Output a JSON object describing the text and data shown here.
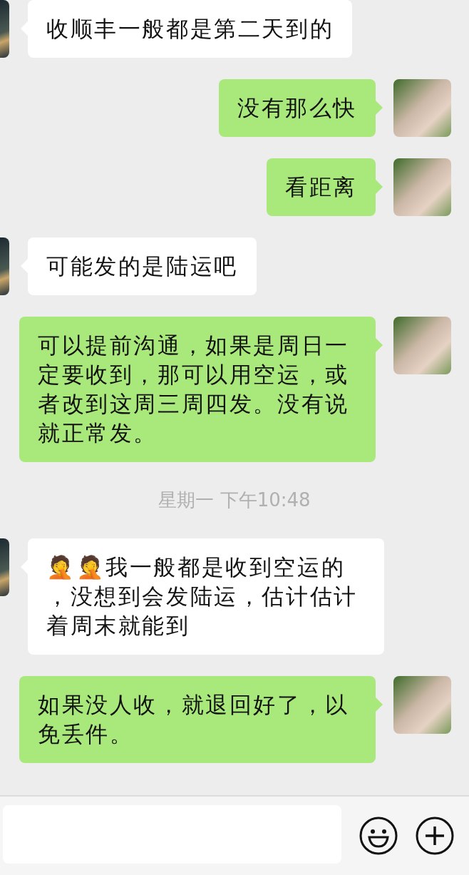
{
  "messages": [
    {
      "kind": "incoming",
      "text": "收顺丰一般都是第二天到的"
    },
    {
      "kind": "outgoing",
      "text": "没有那么快"
    },
    {
      "kind": "outgoing",
      "text": "看距离"
    },
    {
      "kind": "incoming",
      "text": "可能发的是陆运吧"
    },
    {
      "kind": "outgoing",
      "text": "可以提前沟通，如果是周日一定要收到，那可以用空运，或者改到这周三周四发。没有说就正常发。"
    },
    {
      "kind": "time",
      "text": "星期一 下午10:48"
    },
    {
      "kind": "incoming",
      "text": "🤦🤦我一般都是收到空运的，没想到会发陆运，估计估计着周末就能到"
    },
    {
      "kind": "outgoing",
      "text": "如果没人收，就退回好了，以免丢件。"
    }
  ]
}
